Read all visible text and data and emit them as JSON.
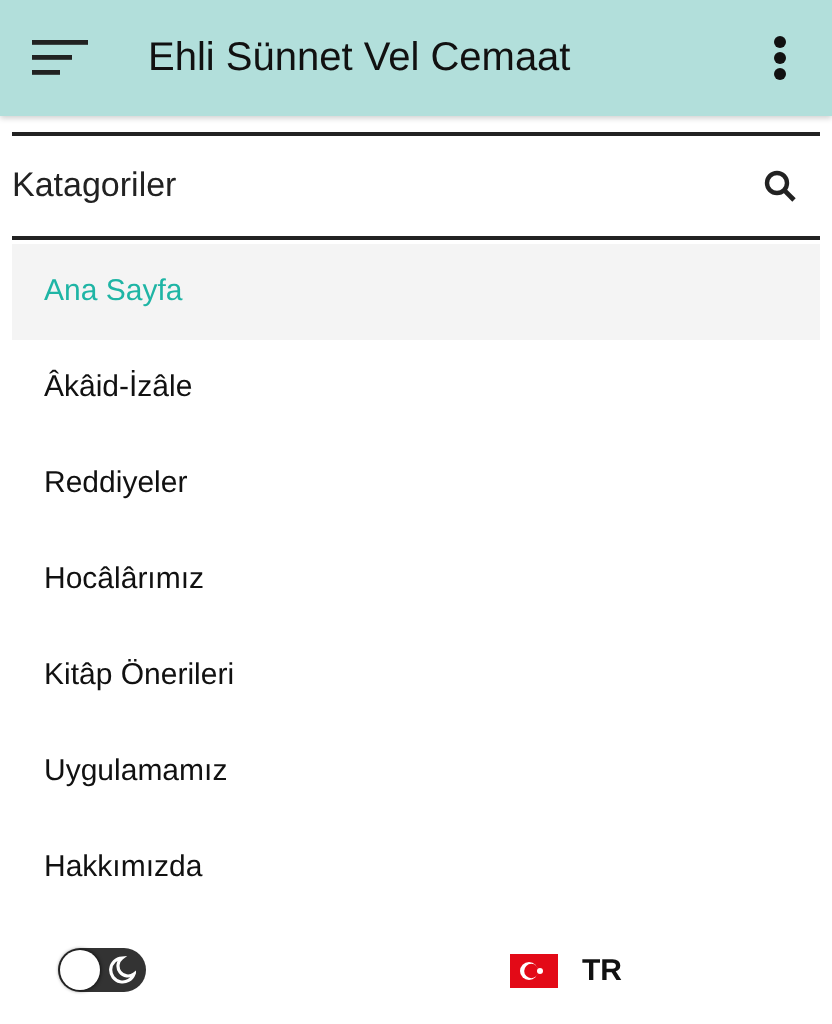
{
  "app_bar": {
    "title": "Ehli Sünnet Vel Cemaat"
  },
  "search": {
    "placeholder": "Katagoriler"
  },
  "menu": [
    {
      "label": "Ana Sayfa",
      "selected": true
    },
    {
      "label": "Âkâid-İzâle",
      "selected": false
    },
    {
      "label": "Reddiyeler",
      "selected": false
    },
    {
      "label": "Hocâlârımız",
      "selected": false
    },
    {
      "label": "Kitâp Önerileri",
      "selected": false
    },
    {
      "label": "Uygulamamız",
      "selected": false
    },
    {
      "label": "Hakkımızda",
      "selected": false
    }
  ],
  "footer": {
    "dark_mode": false,
    "language": "TR"
  }
}
